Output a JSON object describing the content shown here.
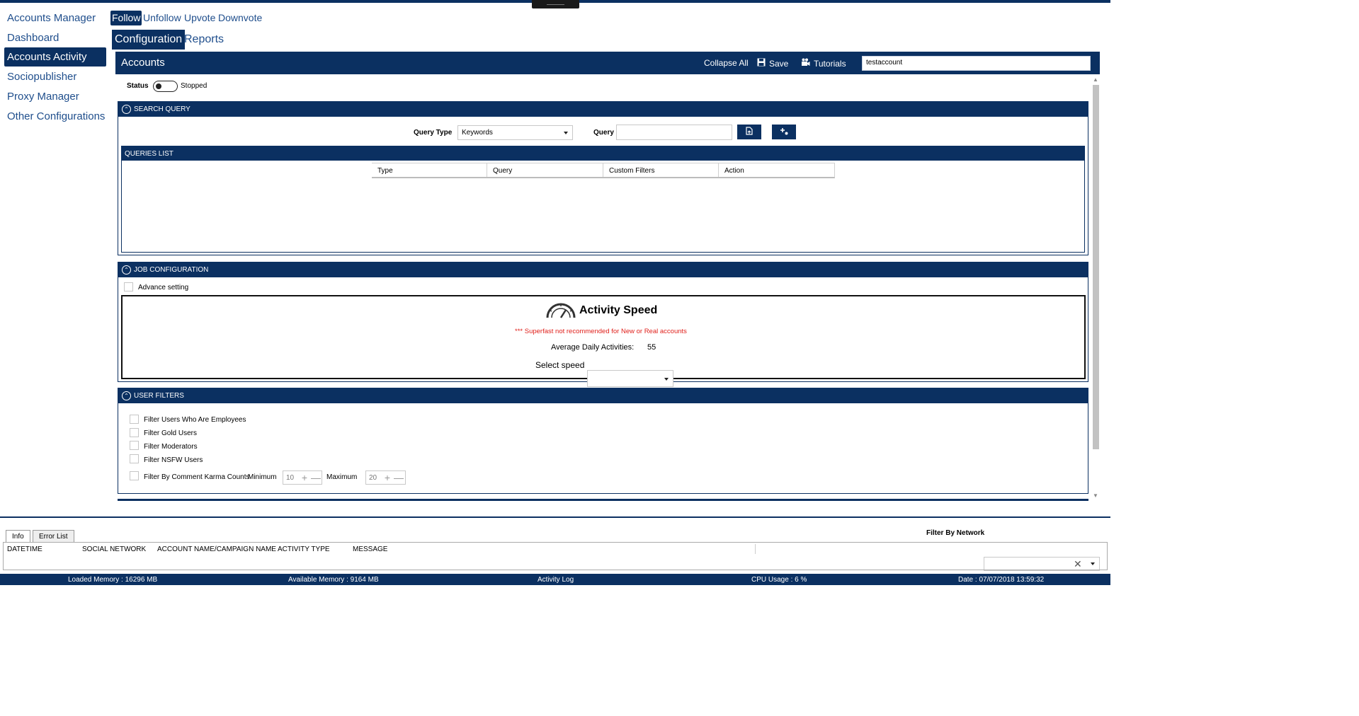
{
  "nav": {
    "items": [
      {
        "label": "Accounts Manager"
      },
      {
        "label": "Dashboard"
      },
      {
        "label": "Accounts Activity"
      },
      {
        "label": "Sociopublisher"
      },
      {
        "label": "Proxy Manager"
      },
      {
        "label": "Other Configurations"
      }
    ]
  },
  "activity_tabs": [
    {
      "label": "Follow"
    },
    {
      "label": "Unfollow"
    },
    {
      "label": "Upvote"
    },
    {
      "label": "Downvote"
    }
  ],
  "sub_tabs": [
    {
      "label": "Configuration"
    },
    {
      "label": "Reports"
    }
  ],
  "header": {
    "title": "Accounts",
    "collapse_all": "Collapse All",
    "save": "Save",
    "tutorials": "Tutorials",
    "account_value": "testaccount"
  },
  "status": {
    "label": "Status",
    "value": "Stopped"
  },
  "search_query": {
    "title": "SEARCH QUERY",
    "query_type_label": "Query Type",
    "query_type_value": "Keywords",
    "query_label": "Query",
    "query_value": ""
  },
  "queries_list": {
    "title": "QUERIES LIST",
    "columns": [
      "Type",
      "Query",
      "Custom Filters",
      "Action"
    ]
  },
  "job_config": {
    "title": "JOB CONFIGURATION",
    "advance_setting": "Advance setting",
    "activity_speed_title": "Activity Speed",
    "warning": "*** Superfast not recommended for New or Real accounts",
    "avg_daily_label": "Average Daily Activities:",
    "avg_daily_value": "55",
    "select_speed_label": "Select speed",
    "select_speed_value": ""
  },
  "user_filters": {
    "title": "USER FILTERS",
    "filters": [
      {
        "label": "Filter Users Who Are Employees"
      },
      {
        "label": "Filter Gold Users"
      },
      {
        "label": "Filter Moderators"
      },
      {
        "label": "Filter NSFW Users"
      }
    ],
    "karma": {
      "label": "Filter By Comment Karma Counts",
      "minimum_label": "Minimum",
      "minimum_value": "10",
      "maximum_label": "Maximum",
      "maximum_value": "20"
    }
  },
  "log": {
    "tabs": [
      "Info",
      "Error List"
    ],
    "filter_label": "Filter By Network",
    "columns": [
      "DATETIME",
      "SOCIAL NETWORK",
      "ACCOUNT NAME/CAMPAIGN NAME",
      "ACTIVITY TYPE",
      "MESSAGE"
    ]
  },
  "status_bar": {
    "loaded_memory": "Loaded Memory : 16296 MB",
    "available_memory": "Available Memory : 9164  MB",
    "activity_log": "Activity Log",
    "cpu_usage": "CPU Usage : 6 %",
    "date": "Date : 07/07/2018 13:59:32"
  },
  "colors": {
    "primary": "#0b3061",
    "link": "#1f4e8c",
    "warning": "#e0201b"
  }
}
